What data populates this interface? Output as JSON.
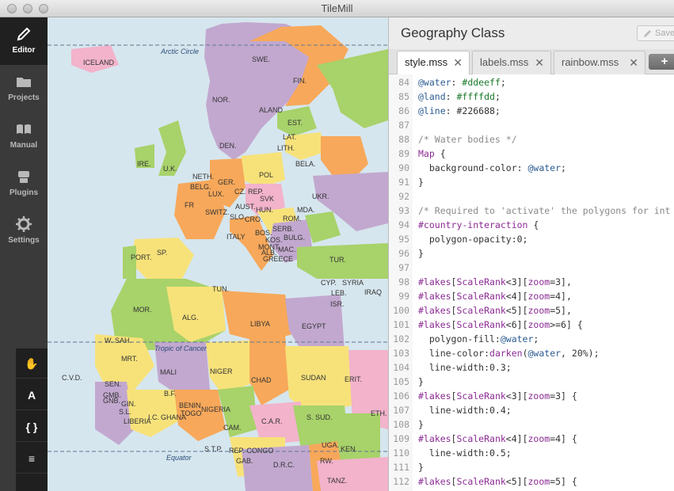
{
  "window": {
    "title": "TileMill"
  },
  "sidebar": {
    "items": [
      {
        "label": "Editor",
        "icon": "pencil-icon",
        "active": true
      },
      {
        "label": "Projects",
        "icon": "folder-icon",
        "active": false
      },
      {
        "label": "Manual",
        "icon": "book-icon",
        "active": false
      },
      {
        "label": "Plugins",
        "icon": "plugin-icon",
        "active": false
      },
      {
        "label": "Settings",
        "icon": "gear-icon",
        "active": false
      }
    ]
  },
  "map_tools": [
    {
      "icon": "hand-icon",
      "glyph": "✋"
    },
    {
      "icon": "text-icon",
      "glyph": "A"
    },
    {
      "icon": "braces-icon",
      "glyph": "{ }"
    },
    {
      "icon": "layers-icon",
      "glyph": "≡"
    }
  ],
  "map": {
    "lines": {
      "arctic": "Arctic Circle",
      "cancer": "Tropic of Cancer",
      "equator": "Equator"
    },
    "countries": [
      "ICELAND",
      "SWE.",
      "FIN.",
      "NOR.",
      "EST.",
      "ALAND",
      "LAT.",
      "LITH.",
      "DEN.",
      "BELA.",
      "IRE.",
      "U.K.",
      "NETH.",
      "POL",
      "BELG.",
      "GER.",
      "UKR.",
      "CZ. REP.",
      "SVK",
      "LUX.",
      "FR",
      "SWITZ.",
      "AUST.",
      "HUN.",
      "MDA.",
      "SLO.",
      "CRO.",
      "ROM.",
      "SERB.",
      "BOS.",
      "BULG.",
      "ITALY",
      "KOS.",
      "MONT.",
      "ALB.",
      "MAC.",
      "GREECE",
      "PORT.",
      "SP.",
      "TUR.",
      "CYP.",
      "SYRIA",
      "LEB.",
      "ISR.",
      "IRAQ",
      "TUN.",
      "MOR.",
      "ALG.",
      "LIBYA",
      "EGYPT",
      "W. SAH.",
      "MRT.",
      "MALI",
      "NIGER",
      "CHAD",
      "SUDAN",
      "ERIT.",
      "C.V.D.",
      "SEN.",
      "GMB.",
      "GNB.",
      "GIN.",
      "S.L.",
      "B.F.",
      "BENIN",
      "NIGERIA",
      "LIBERIA",
      "I.C.",
      "GHANA",
      "TOGO",
      "ETH.",
      "C.A.R.",
      "S. SUD.",
      "CAM.",
      "S.T.P.",
      "GAB.",
      "REP. CONGO",
      "UGA.",
      "KEN.",
      "D.R.C.",
      "RW.",
      "TANZ."
    ]
  },
  "editor": {
    "project_title": "Geography Class",
    "save_label": "Save",
    "tabs": [
      {
        "label": "style.mss",
        "active": true
      },
      {
        "label": "labels.mss",
        "active": false
      },
      {
        "label": "rainbow.mss",
        "active": false
      }
    ],
    "add_tab_label": "+",
    "code_lines": [
      {
        "n": "84",
        "text": "@water: #ddeeff;"
      },
      {
        "n": "85",
        "text": "@land: #ffffdd;"
      },
      {
        "n": "86",
        "text": "@line: #226688;"
      },
      {
        "n": "87",
        "text": ""
      },
      {
        "n": "88",
        "text": "/* Water bodies */"
      },
      {
        "n": "89",
        "text": "Map {"
      },
      {
        "n": "90",
        "text": "  background-color: @water;"
      },
      {
        "n": "91",
        "text": "}"
      },
      {
        "n": "92",
        "text": ""
      },
      {
        "n": "93",
        "text": "/* Required to 'activate' the polygons for int"
      },
      {
        "n": "94",
        "text": "#country-interaction {"
      },
      {
        "n": "95",
        "text": "  polygon-opacity:0;"
      },
      {
        "n": "96",
        "text": "}"
      },
      {
        "n": "97",
        "text": ""
      },
      {
        "n": "98",
        "text": "#lakes[ScaleRank<3][zoom=3],"
      },
      {
        "n": "99",
        "text": "#lakes[ScaleRank<4][zoom=4],"
      },
      {
        "n": "100",
        "text": "#lakes[ScaleRank<5][zoom=5],"
      },
      {
        "n": "101",
        "text": "#lakes[ScaleRank<6][zoom>=6] {"
      },
      {
        "n": "102",
        "text": "  polygon-fill:@water;"
      },
      {
        "n": "103",
        "text": "  line-color:darken(@water, 20%);"
      },
      {
        "n": "104",
        "text": "  line-width:0.3;"
      },
      {
        "n": "105",
        "text": "}"
      },
      {
        "n": "106",
        "text": "#lakes[ScaleRank<3][zoom=3] {"
      },
      {
        "n": "107",
        "text": "  line-width:0.4;"
      },
      {
        "n": "108",
        "text": "}"
      },
      {
        "n": "109",
        "text": "#lakes[ScaleRank<4][zoom=4] {"
      },
      {
        "n": "110",
        "text": "  line-width:0.5;"
      },
      {
        "n": "111",
        "text": "}"
      },
      {
        "n": "112",
        "text": "#lakes[ScaleRank<5][zoom=5] {"
      }
    ]
  },
  "colors": {
    "water": "#d6e6ee",
    "sidebar": "#3a3a3a",
    "sidebar_active": "#202020",
    "land_orange": "#f7a85a",
    "land_yellow": "#f7e27a",
    "land_green": "#a8d26a",
    "land_purple": "#c2a8cf",
    "land_pink": "#f2b3cb"
  }
}
